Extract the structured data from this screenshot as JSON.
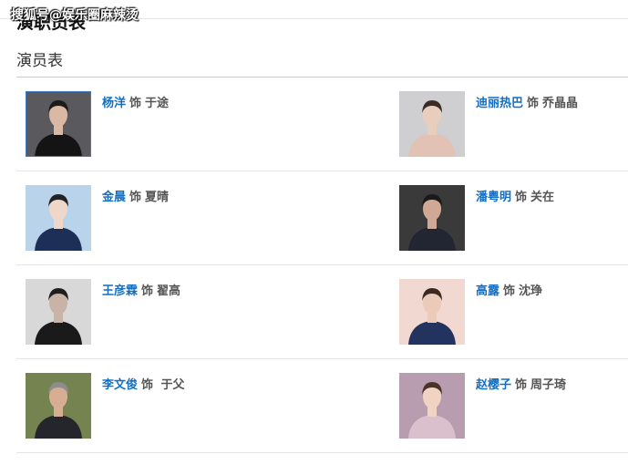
{
  "watermark": "搜狐号@娱乐圈麻辣烫",
  "overlay_title": "演职员表",
  "section_title": "演员表",
  "cast": [
    {
      "actor": "杨洋",
      "as": "饰",
      "role": "于途",
      "photo": {
        "bg": "#5a5a5e",
        "skin": "#d9b8a4",
        "hair": "#1b1b1b",
        "cloth": "#141414",
        "border": "#3d7bbf"
      }
    },
    {
      "actor": "迪丽热巴",
      "as": "饰",
      "role": "乔晶晶",
      "photo": {
        "bg": "#cfcfd1",
        "skin": "#e9cdbd",
        "hair": "#3a2b24",
        "cloth": "#e3c2b6",
        "border": ""
      }
    },
    {
      "actor": "金晨",
      "as": "饰",
      "role": "夏晴",
      "photo": {
        "bg": "#b9d3ea",
        "skin": "#eed6c8",
        "hair": "#222222",
        "cloth": "#1d2f57",
        "border": ""
      }
    },
    {
      "actor": "潘粤明",
      "as": "饰",
      "role": "关在",
      "photo": {
        "bg": "#3a3a3a",
        "skin": "#cfa995",
        "hair": "#1a1a1a",
        "cloth": "#222633",
        "border": ""
      }
    },
    {
      "actor": "王彦霖",
      "as": "饰",
      "role": "翟高",
      "photo": {
        "bg": "#d8d8d8",
        "skin": "#c9b3a6",
        "hair": "#1e1e1e",
        "cloth": "#1a1a1a",
        "border": ""
      }
    },
    {
      "actor": "高露",
      "as": "饰",
      "role": "沈琤",
      "photo": {
        "bg": "#f1d9d1",
        "skin": "#eccab9",
        "hair": "#3b2a22",
        "cloth": "#22335f",
        "border": ""
      }
    },
    {
      "actor": "李文俊",
      "as": "饰",
      "role": " 于父",
      "photo": {
        "bg": "#74834f",
        "skin": "#d7ad93",
        "hair": "#8d8d8d",
        "cloth": "#24262b",
        "border": ""
      }
    },
    {
      "actor": "赵樱子",
      "as": "饰",
      "role": "周子琦",
      "photo": {
        "bg": "#b89cb0",
        "skin": "#f0d3c2",
        "hair": "#4a3227",
        "cloth": "#d9c0cc",
        "border": ""
      }
    }
  ]
}
